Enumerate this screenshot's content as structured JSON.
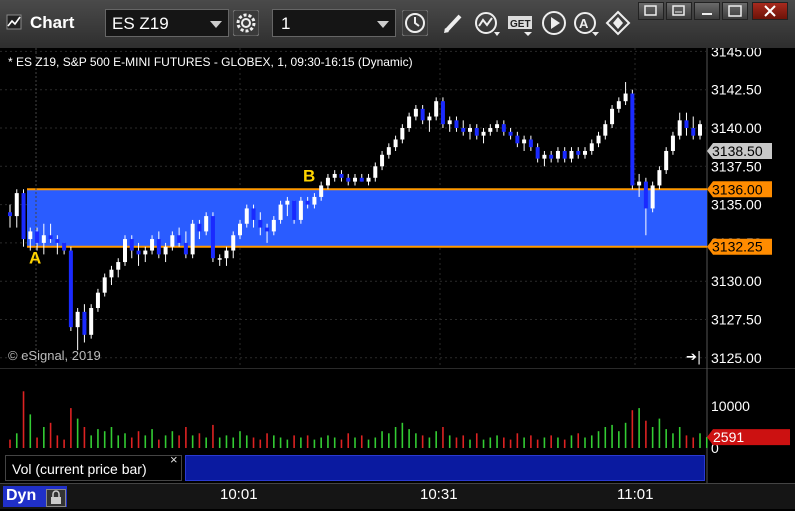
{
  "app": {
    "title": "Chart"
  },
  "toolbar": {
    "symbol": "ES Z19",
    "interval": "1"
  },
  "chart": {
    "header": "* ES Z19, S&P 500 E-MINI FUTURES - GLOBEX, 1, 09:30-16:15 (Dynamic)",
    "copyright": "© eSignal, 2019",
    "price_ticks": [
      "3145.00",
      "3142.50",
      "3140.00",
      "3137.50",
      "3135.00",
      "3132.50",
      "3130.00",
      "3127.50",
      "3125.00"
    ],
    "tags": {
      "last": "3138.50",
      "upper": "3136.00",
      "lower": "3132.25"
    },
    "annotations": {
      "a": "A",
      "b": "B"
    },
    "colors": {
      "band": "#2a5cff",
      "line": "#ff9900",
      "up": "#ffffff",
      "down": "#1a2aff",
      "last_tag": "#c8c8c8"
    },
    "candles": [
      [
        3134.5,
        3135,
        3133.5,
        3134.25
      ],
      [
        3134.25,
        3136,
        3133.5,
        3135.75
      ],
      [
        3135.75,
        3136,
        3132.25,
        3132.75
      ],
      [
        3132.75,
        3133.5,
        3132,
        3133.25
      ],
      [
        3133.25,
        3133.5,
        3132,
        3132.5
      ],
      [
        3132.5,
        3133.75,
        3131.75,
        3133
      ],
      [
        3133,
        3133.75,
        3132.5,
        3132.75
      ],
      [
        3132.75,
        3133,
        3131.75,
        3132.5
      ],
      [
        3132.5,
        3132.5,
        3131.75,
        3132
      ],
      [
        3132,
        3132.25,
        3126.75,
        3127
      ],
      [
        3127,
        3128.25,
        3125.5,
        3128
      ],
      [
        3128,
        3128.5,
        3126,
        3126.5
      ],
      [
        3126.5,
        3128.5,
        3126.25,
        3128.25
      ],
      [
        3128.25,
        3129.5,
        3128,
        3129.25
      ],
      [
        3129.25,
        3130.5,
        3129,
        3130.25
      ],
      [
        3130.25,
        3131,
        3129.75,
        3130.75
      ],
      [
        3130.75,
        3131.5,
        3130.25,
        3131.25
      ],
      [
        3131.25,
        3133,
        3131,
        3132.75
      ],
      [
        3132.75,
        3133,
        3131.5,
        3132
      ],
      [
        3132,
        3132.5,
        3131,
        3131.75
      ],
      [
        3131.75,
        3132.25,
        3131.25,
        3132
      ],
      [
        3132,
        3133,
        3131.75,
        3132.75
      ],
      [
        3132.75,
        3133.25,
        3131.5,
        3131.75
      ],
      [
        3131.75,
        3132.5,
        3131.25,
        3132.25
      ],
      [
        3132.25,
        3133.25,
        3132,
        3133
      ],
      [
        3133,
        3133.5,
        3132.25,
        3132.5
      ],
      [
        3132.5,
        3133.25,
        3131.5,
        3131.75
      ],
      [
        3131.75,
        3134,
        3131.5,
        3133.75
      ],
      [
        3133.75,
        3134,
        3132.75,
        3133.25
      ],
      [
        3133.25,
        3134.5,
        3133,
        3134.25
      ],
      [
        3134.25,
        3134.5,
        3131.25,
        3131.5
      ],
      [
        3131.5,
        3131.75,
        3131,
        3131.5
      ],
      [
        3131.5,
        3132.25,
        3131,
        3132
      ],
      [
        3132,
        3133.25,
        3131.5,
        3133
      ],
      [
        3133,
        3134,
        3132.75,
        3133.75
      ],
      [
        3133.75,
        3135,
        3133.5,
        3134.75
      ],
      [
        3134.75,
        3135,
        3133.5,
        3134
      ],
      [
        3134,
        3134.5,
        3133,
        3133.5
      ],
      [
        3133.5,
        3133.75,
        3132.5,
        3133.25
      ],
      [
        3133.25,
        3134.25,
        3133,
        3134
      ],
      [
        3134,
        3135.25,
        3133.75,
        3135
      ],
      [
        3135,
        3135.5,
        3134.25,
        3135.25
      ],
      [
        3135.25,
        3135.25,
        3133.75,
        3134
      ],
      [
        3134,
        3135.5,
        3133.75,
        3135.25
      ],
      [
        3135.25,
        3135.5,
        3134.75,
        3135
      ],
      [
        3135,
        3135.75,
        3134.75,
        3135.5
      ],
      [
        3135.5,
        3136.5,
        3135.25,
        3136.25
      ],
      [
        3136.25,
        3137,
        3136,
        3136.75
      ],
      [
        3136.75,
        3137.25,
        3136.5,
        3137
      ],
      [
        3137,
        3137.25,
        3136.5,
        3136.75
      ],
      [
        3136.75,
        3137,
        3136.25,
        3136.5
      ],
      [
        3136.5,
        3137,
        3136.25,
        3136.75
      ],
      [
        3136.75,
        3137,
        3136.5,
        3136.5
      ],
      [
        3136.5,
        3137,
        3136.25,
        3136.75
      ],
      [
        3136.75,
        3137.75,
        3136.5,
        3137.5
      ],
      [
        3137.5,
        3138.5,
        3137.25,
        3138.25
      ],
      [
        3138.25,
        3139,
        3138,
        3138.75
      ],
      [
        3138.75,
        3139.5,
        3138.5,
        3139.25
      ],
      [
        3139.25,
        3140.25,
        3139,
        3140
      ],
      [
        3140,
        3141,
        3139.75,
        3140.75
      ],
      [
        3140.75,
        3141.5,
        3140.5,
        3141.25
      ],
      [
        3141.25,
        3141.5,
        3140.25,
        3140.5
      ],
      [
        3140.5,
        3141,
        3139.75,
        3140.75
      ],
      [
        3140.75,
        3142,
        3140.5,
        3141.75
      ],
      [
        3141.75,
        3142,
        3140,
        3140.25
      ],
      [
        3140.25,
        3140.75,
        3139.75,
        3140.5
      ],
      [
        3140.5,
        3140.75,
        3139.75,
        3140
      ],
      [
        3140,
        3140.5,
        3139.5,
        3139.75
      ],
      [
        3139.75,
        3140.25,
        3139.25,
        3140
      ],
      [
        3140,
        3140.25,
        3139.25,
        3139.5
      ],
      [
        3139.5,
        3140,
        3139,
        3139.75
      ],
      [
        3139.75,
        3140.25,
        3139.5,
        3140
      ],
      [
        3140,
        3140.5,
        3139.75,
        3140.25
      ],
      [
        3140.25,
        3140.5,
        3139.5,
        3139.75
      ],
      [
        3139.75,
        3140,
        3139.25,
        3139.5
      ],
      [
        3139.5,
        3139.75,
        3138.75,
        3139
      ],
      [
        3139,
        3139.5,
        3138.5,
        3139.25
      ],
      [
        3139.25,
        3139.5,
        3138.5,
        3138.75
      ],
      [
        3138.75,
        3139,
        3137.75,
        3138
      ],
      [
        3138,
        3138.5,
        3137.5,
        3138.25
      ],
      [
        3138.25,
        3138.5,
        3137.75,
        3138
      ],
      [
        3138,
        3138.75,
        3137.75,
        3138.5
      ],
      [
        3138.5,
        3138.75,
        3137.75,
        3138
      ],
      [
        3138,
        3138.75,
        3137.75,
        3138.5
      ],
      [
        3138.5,
        3138.75,
        3138,
        3138.25
      ],
      [
        3138.25,
        3138.75,
        3138,
        3138.5
      ],
      [
        3138.5,
        3139.25,
        3138.25,
        3139
      ],
      [
        3139,
        3139.75,
        3138.75,
        3139.5
      ],
      [
        3139.5,
        3140.5,
        3139.25,
        3140.25
      ],
      [
        3140.25,
        3141.5,
        3140,
        3141.25
      ],
      [
        3141.25,
        3142,
        3141,
        3141.75
      ],
      [
        3141.75,
        3143,
        3141.5,
        3142.25
      ],
      [
        3142.25,
        3142.5,
        3136,
        3136.25
      ],
      [
        3136.25,
        3137,
        3135.5,
        3136.5
      ],
      [
        3136.5,
        3136.75,
        3133,
        3134.75
      ],
      [
        3134.75,
        3136.5,
        3134.5,
        3136.25
      ],
      [
        3136.25,
        3137.5,
        3136,
        3137.25
      ],
      [
        3137.25,
        3138.75,
        3137,
        3138.5
      ],
      [
        3138.5,
        3139.75,
        3138.25,
        3139.5
      ],
      [
        3139.5,
        3141,
        3139.25,
        3140.5
      ],
      [
        3140.5,
        3141,
        3139.5,
        3140
      ],
      [
        3140,
        3140.75,
        3139.25,
        3139.5
      ],
      [
        3139.5,
        3140.5,
        3139.25,
        3140.25
      ]
    ],
    "volume_ticks": [
      "10000",
      "0"
    ],
    "volume_last": "2591",
    "volumes": [
      2000,
      3500,
      13500,
      8000,
      2500,
      5000,
      6000,
      3000,
      2000,
      9500,
      7000,
      5000,
      3000,
      4500,
      4000,
      5000,
      3000,
      3500,
      2500,
      4000,
      3000,
      4500,
      2000,
      3000,
      4000,
      3000,
      5000,
      3000,
      3500,
      2500,
      5500,
      2500,
      3000,
      2500,
      4000,
      3000,
      2500,
      2000,
      3500,
      3000,
      2500,
      2000,
      3000,
      2500,
      3000,
      2000,
      2500,
      3000,
      2500,
      2000,
      3500,
      2500,
      3000,
      2000,
      2500,
      4000,
      3500,
      5000,
      6000,
      4500,
      3500,
      3000,
      2500,
      4000,
      5000,
      3000,
      2500,
      3000,
      2000,
      3500,
      2000,
      2500,
      3000,
      2500,
      2000,
      3500,
      2500,
      3000,
      2000,
      2500,
      3000,
      2500,
      2000,
      3000,
      3500,
      2500,
      3000,
      4000,
      5000,
      5500,
      4000,
      6000,
      9000,
      9500,
      6500,
      5000,
      7000,
      4500,
      3500,
      5000,
      3000,
      2500,
      3500,
      2591
    ],
    "volume_label": "Vol (current price bar)",
    "time_labels": [
      "10:01",
      "10:31",
      "11:01"
    ],
    "bottom_button": "Dyn"
  }
}
